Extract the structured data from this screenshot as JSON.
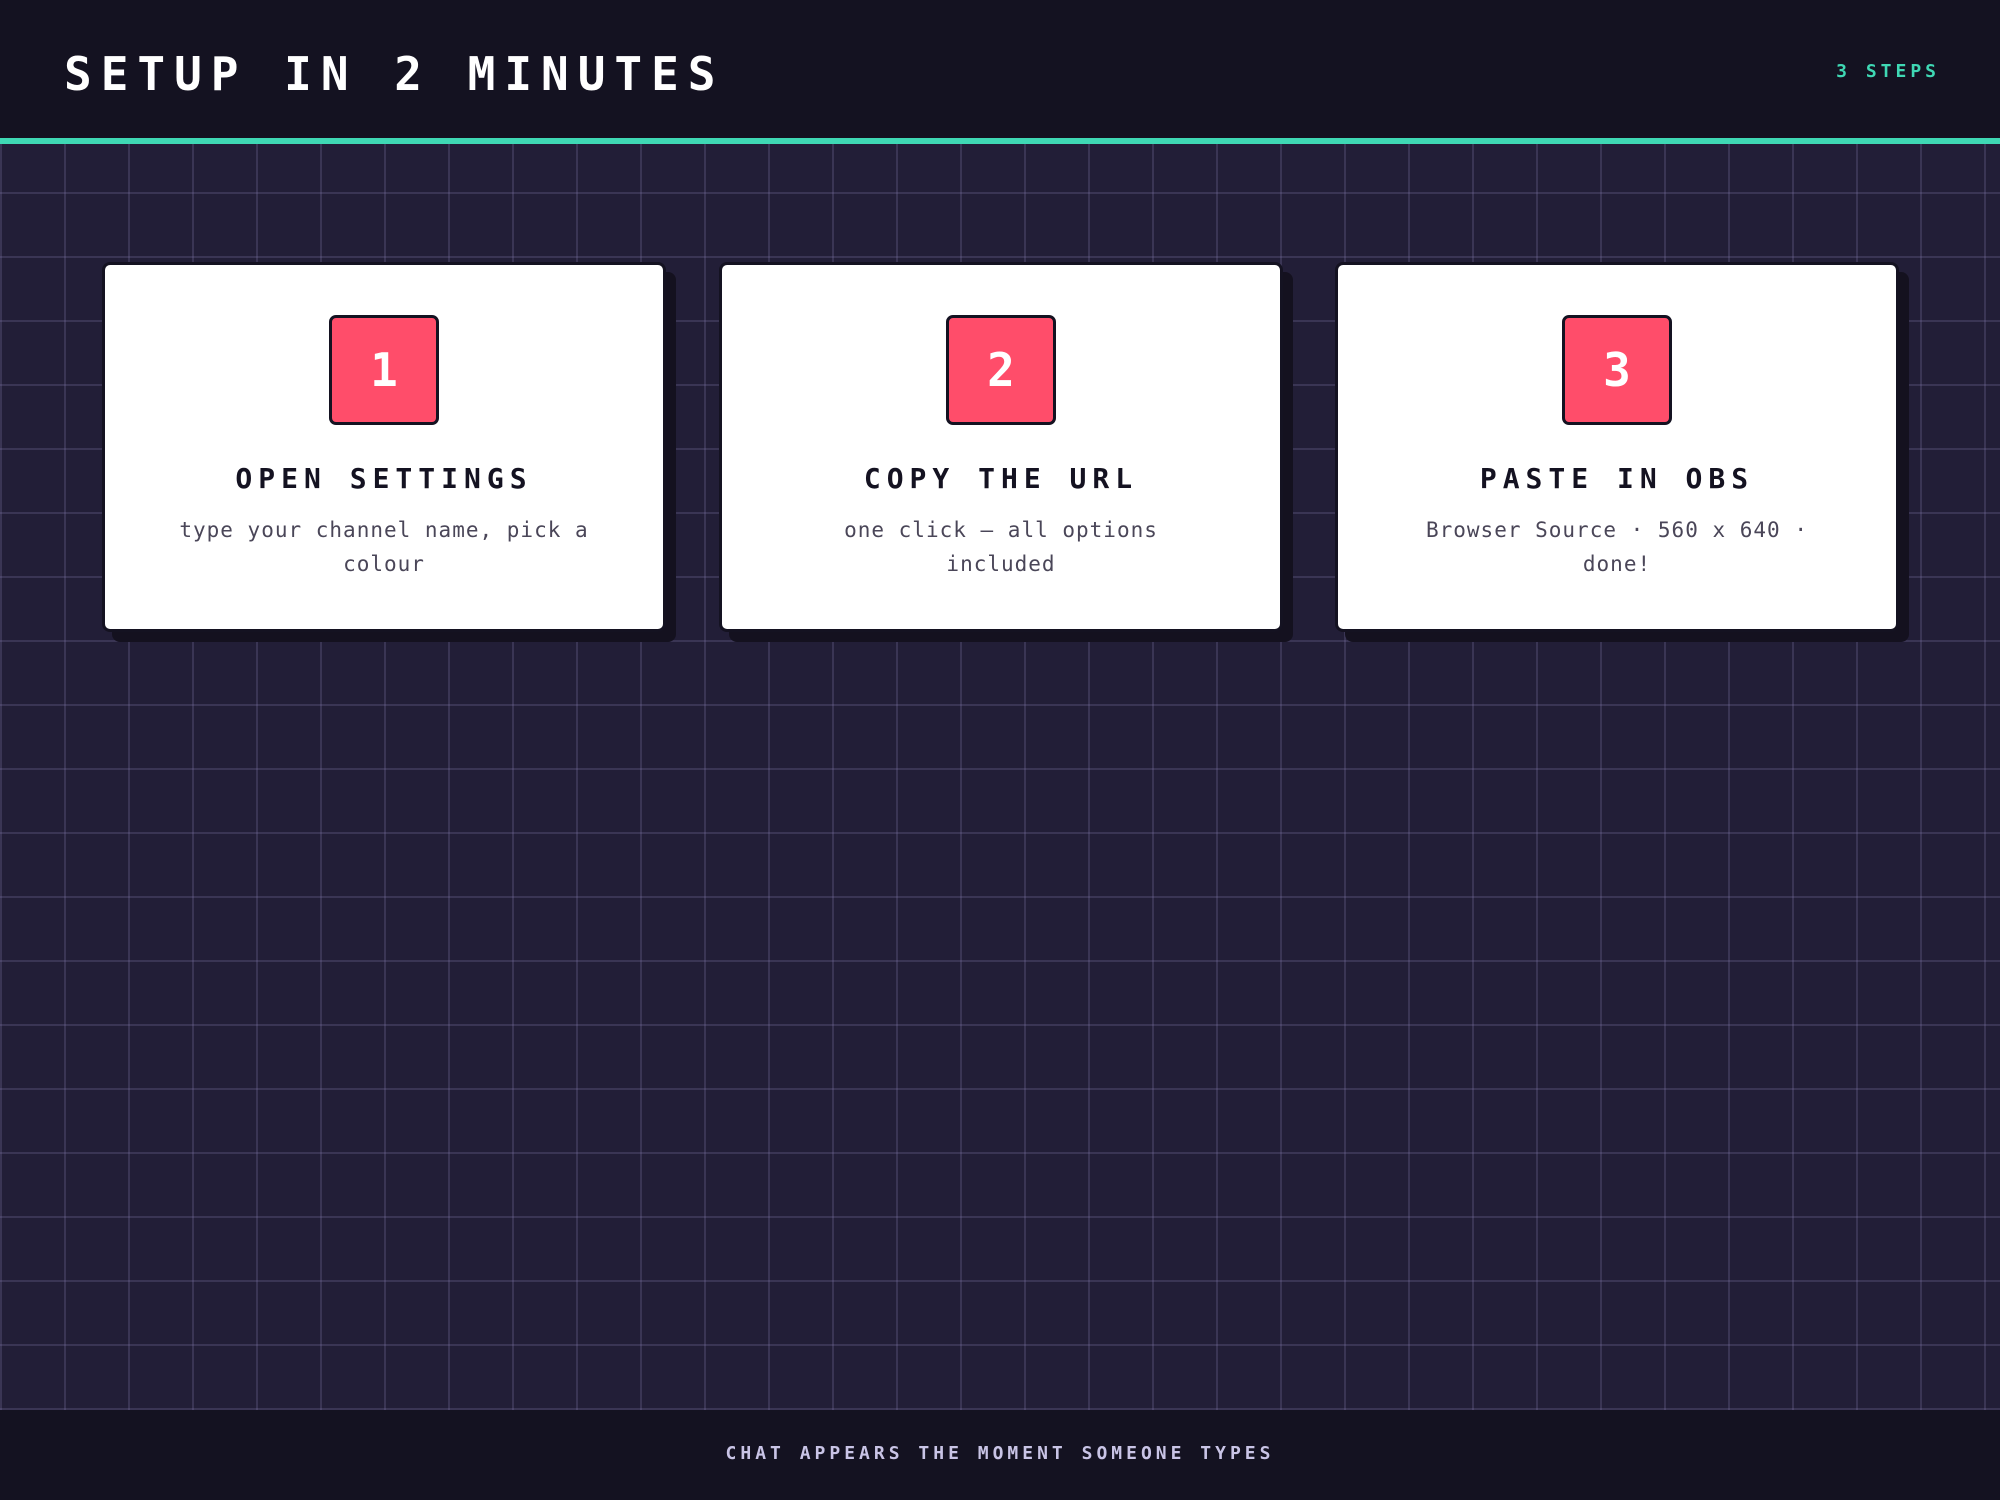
{
  "header": {
    "title": "SETUP IN 2 MINUTES",
    "meta": "3 STEPS"
  },
  "steps": [
    {
      "number": "1",
      "title": "OPEN SETTINGS",
      "description": "type your channel name, pick a colour"
    },
    {
      "number": "2",
      "title": "COPY THE URL",
      "description": "one click — all options included"
    },
    {
      "number": "3",
      "title": "PASTE IN OBS",
      "description": "Browser Source · 560 x 640 · done!"
    }
  ],
  "footer": {
    "text": "CHAT APPEARS THE MOMENT SOMEONE TYPES"
  },
  "colors": {
    "background": "#221e37",
    "bar": "#141221",
    "accent": "#3fd8b4",
    "badge": "#ff4d6a",
    "card": "#ffffff"
  }
}
